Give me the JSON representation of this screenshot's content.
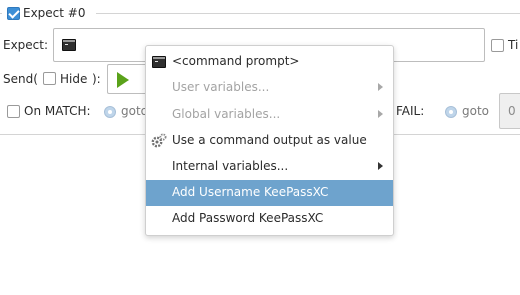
{
  "expect_group": {
    "checkbox_label": "Expect #0",
    "checked": true
  },
  "expect_row": {
    "label": "Expect:",
    "right_checkbox_label": "Ti"
  },
  "send_row": {
    "label_prefix": "Send(",
    "hide_label": "Hide",
    "label_suffix": "):"
  },
  "match_row": {
    "on_match_label": "On MATCH:",
    "goto_label": "goto",
    "fail_label": "FAIL:",
    "fail_goto_label": "goto",
    "spin_value": "0"
  },
  "context_menu": {
    "items": [
      {
        "label": "<command prompt>",
        "icon": "terminal-icon",
        "disabled": false,
        "submenu": false
      },
      {
        "label": "User variables...",
        "icon": "",
        "disabled": true,
        "submenu": true
      },
      {
        "label": "Global variables...",
        "icon": "",
        "disabled": true,
        "submenu": true
      },
      {
        "label": "Use a command output as value",
        "icon": "gears-icon",
        "disabled": false,
        "submenu": false
      },
      {
        "label": "Internal variables...",
        "icon": "",
        "disabled": false,
        "submenu": true
      },
      {
        "label": "Add Username KeePassXC",
        "icon": "",
        "disabled": false,
        "submenu": false,
        "highlighted": true
      },
      {
        "label": "Add Password KeePassXC",
        "icon": "",
        "disabled": false,
        "submenu": false
      }
    ]
  },
  "colors": {
    "highlight": "#6ea3cd",
    "checkbox_checked": "#3d8fd6",
    "play_green": "#5aa21a"
  }
}
